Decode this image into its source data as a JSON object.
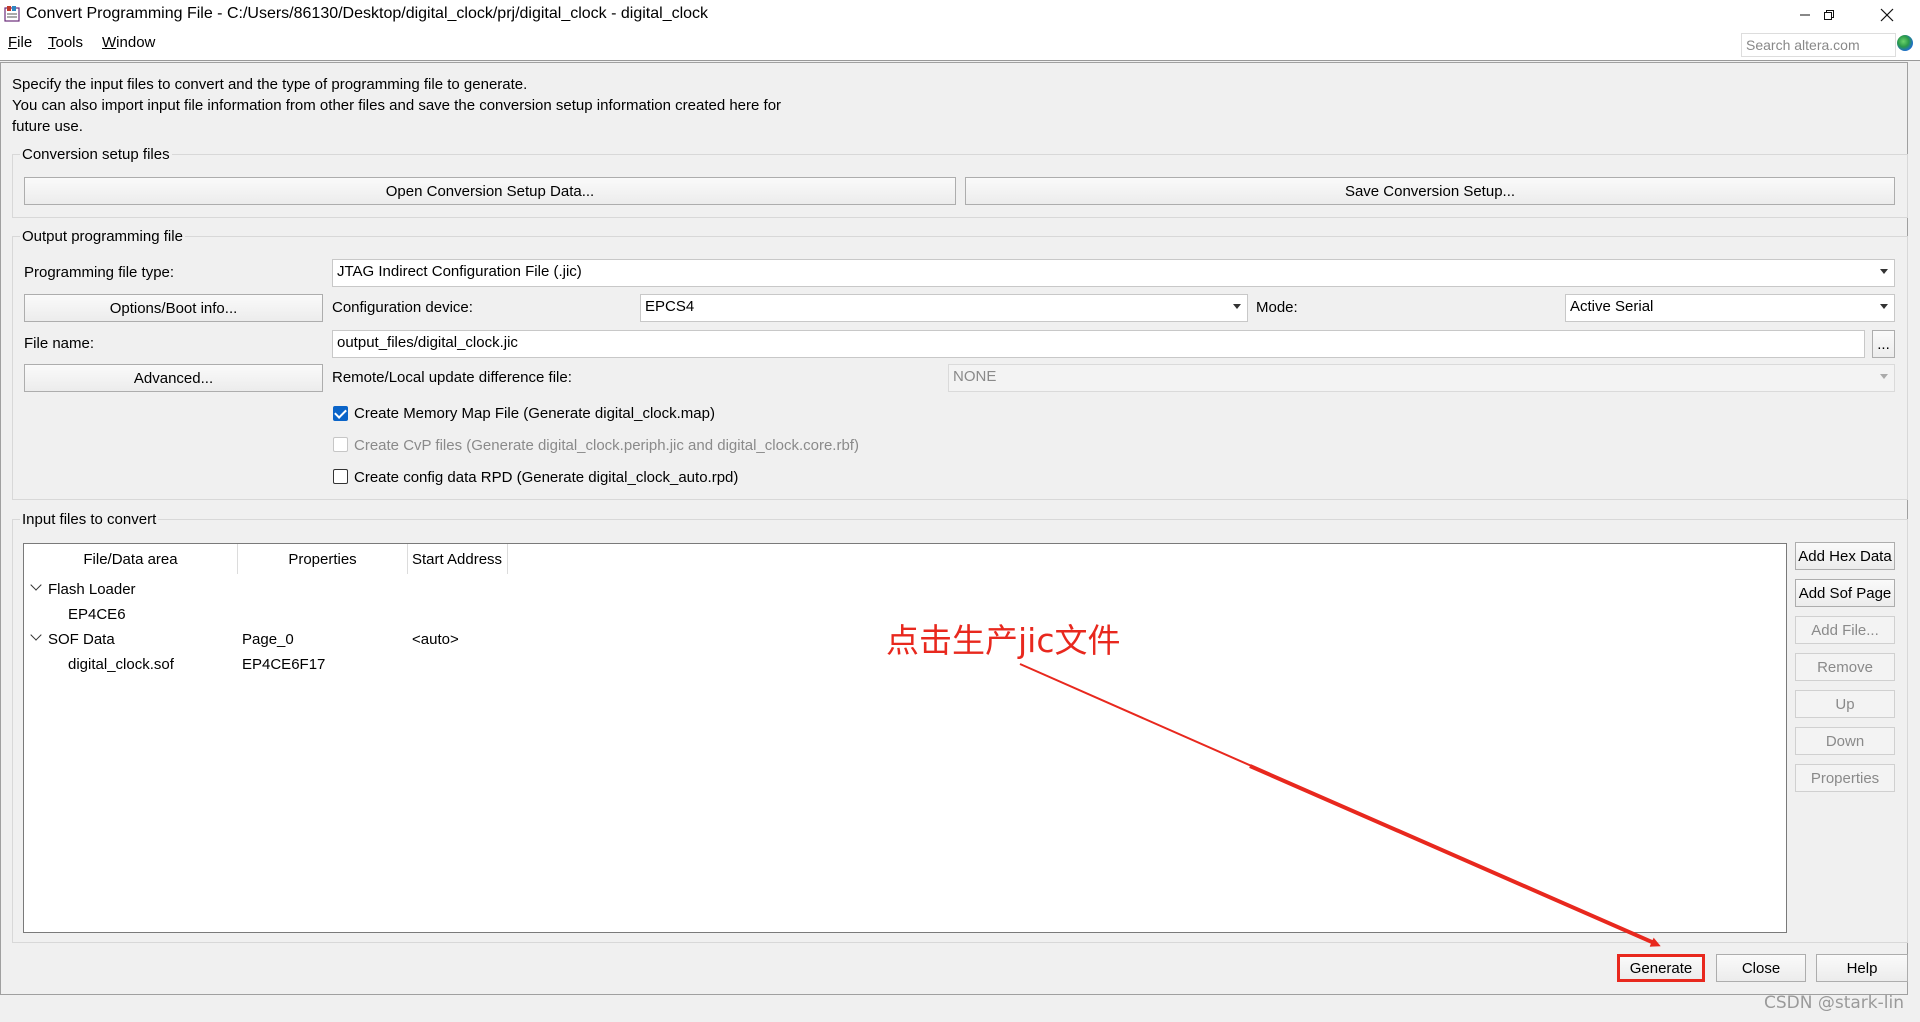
{
  "window": {
    "title": "Convert Programming File - C:/Users/86130/Desktop/digital_clock/prj/digital_clock - digital_clock",
    "minimize_icon": "minimize-icon",
    "restore_icon": "restore-icon",
    "close_icon": "close-icon"
  },
  "menu": {
    "items": [
      {
        "pre": "",
        "ul": "F",
        "post": "ile"
      },
      {
        "pre": "",
        "ul": "T",
        "post": "ools"
      },
      {
        "pre": "",
        "ul": "W",
        "post": "indow"
      }
    ],
    "search_placeholder": "Search altera.com"
  },
  "description": {
    "line1": "Specify the input files to convert and the type of programming file to generate.",
    "line2": "You can also import input file information from other files and save the conversion setup information created here for",
    "line3": "future use."
  },
  "setup": {
    "title": "Conversion setup files",
    "open_label": "Open Conversion Setup Data...",
    "save_label": "Save Conversion Setup..."
  },
  "output": {
    "title": "Output programming file",
    "type_label": "Programming file type:",
    "type_value": "JTAG Indirect Configuration File (.jic)",
    "options_button": "Options/Boot info...",
    "config_device_label": "Configuration device:",
    "config_device_value": "EPCS4",
    "mode_label": "Mode:",
    "mode_value": "Active Serial",
    "file_name_label": "File name:",
    "file_name_value": "output_files/digital_clock.jic",
    "browse_button": "...",
    "advanced_button": "Advanced...",
    "remote_label": "Remote/Local update difference file:",
    "remote_value": "NONE",
    "cb_memory_map": "Create Memory Map File (Generate digital_clock.map)",
    "cb_memory_map_checked": true,
    "cb_cvp": "Create CvP files (Generate digital_clock.periph.jic and digital_clock.core.rbf)",
    "cb_cvp_checked": false,
    "cb_rpd": "Create config data RPD (Generate digital_clock_auto.rpd)",
    "cb_rpd_checked": false
  },
  "input": {
    "title": "Input files to convert",
    "columns": [
      "File/Data area",
      "Properties",
      "Start Address"
    ],
    "rows": [
      {
        "name": "Flash Loader",
        "properties": "",
        "address": "",
        "expanded": true
      },
      {
        "name": "EP4CE6",
        "properties": "",
        "address": ""
      },
      {
        "name": "SOF Data",
        "properties": "Page_0",
        "address": "<auto>",
        "expanded": true
      },
      {
        "name": "digital_clock.sof",
        "properties": "EP4CE6F17",
        "address": ""
      }
    ],
    "side_buttons": [
      {
        "label": "Add Hex Data",
        "enabled": true
      },
      {
        "label": "Add Sof Page",
        "enabled": true
      },
      {
        "label": "Add File...",
        "enabled": false
      },
      {
        "label": "Remove",
        "enabled": false
      },
      {
        "label": "Up",
        "enabled": false
      },
      {
        "label": "Down",
        "enabled": false
      },
      {
        "label": "Properties",
        "enabled": false
      }
    ]
  },
  "footer": {
    "generate": "Generate",
    "close": "Close",
    "help": "Help"
  },
  "annotation": {
    "text": "点击生产jic文件",
    "color": "#e8281e"
  },
  "watermark": "CSDN @stark-lin"
}
